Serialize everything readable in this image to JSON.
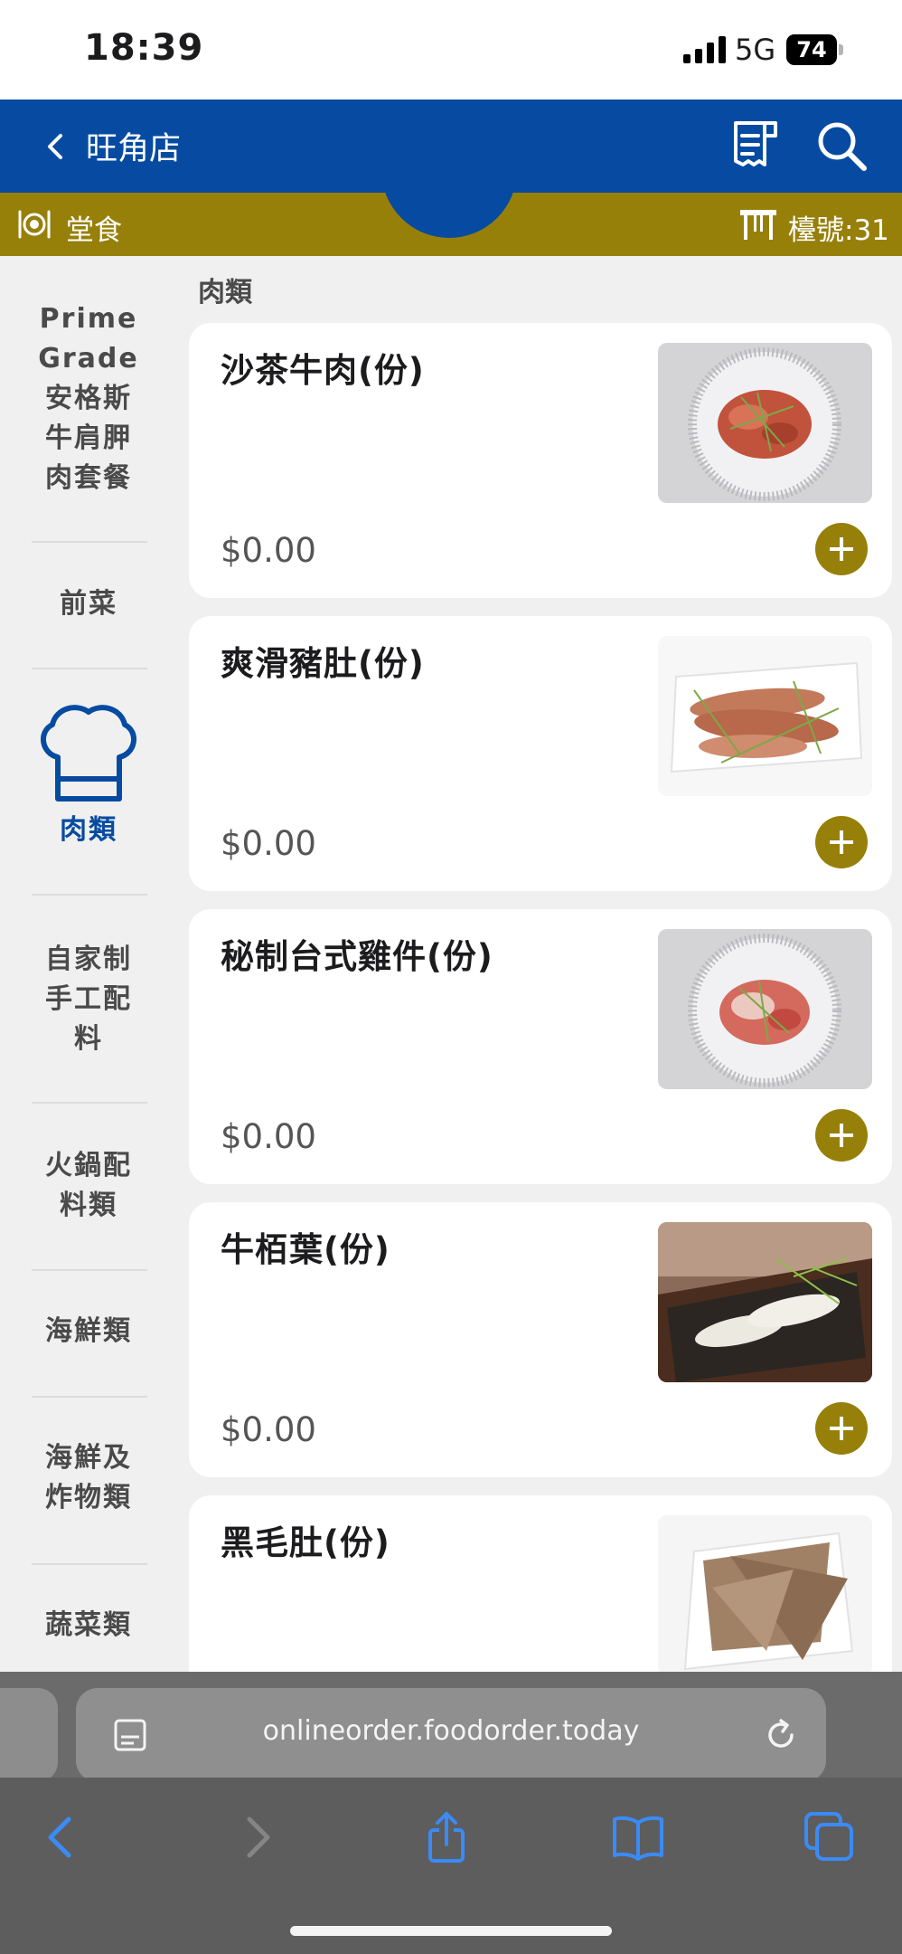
{
  "status_bar": {
    "time": "18:39",
    "network": "5G",
    "battery": "74"
  },
  "header": {
    "store_name": "旺角店"
  },
  "subbar": {
    "mode": "堂食",
    "table": "檯號:31"
  },
  "sidebar": {
    "categories": [
      {
        "label": "Prime\nGrade\n安格斯\n牛肩胛\n肉套餐",
        "active": false
      },
      {
        "label": "前菜",
        "active": false
      },
      {
        "label": "肉類",
        "active": true
      },
      {
        "label": "自家制\n手工配\n料",
        "active": false
      },
      {
        "label": "火鍋配\n料類",
        "active": false
      },
      {
        "label": "海鮮類",
        "active": false
      },
      {
        "label": "海鮮及\n炸物類",
        "active": false
      },
      {
        "label": "蔬菜類",
        "active": false
      }
    ]
  },
  "main": {
    "section_title": "肉類",
    "items": [
      {
        "name": "沙茶牛肉(份)",
        "price": "$0.00"
      },
      {
        "name": "爽滑豬肚(份)",
        "price": "$0.00"
      },
      {
        "name": "秘制台式雞件(份)",
        "price": "$0.00"
      },
      {
        "name": "牛栢葉(份)",
        "price": "$0.00"
      },
      {
        "name": "黑毛肚(份)",
        "price": ""
      }
    ]
  },
  "browser": {
    "url": "onlineorder.foodorder.today"
  },
  "colors": {
    "brand_blue": "#064ba1",
    "accent_gold": "#97800a",
    "background": "#f0f0f0"
  },
  "icons": {
    "back": "chevron-left-icon",
    "orders": "receipt-icon",
    "search": "search-icon",
    "dine_in": "plate-cutlery-icon",
    "table": "table-icon",
    "active_category": "chef-hat-icon",
    "add": "plus-icon"
  }
}
